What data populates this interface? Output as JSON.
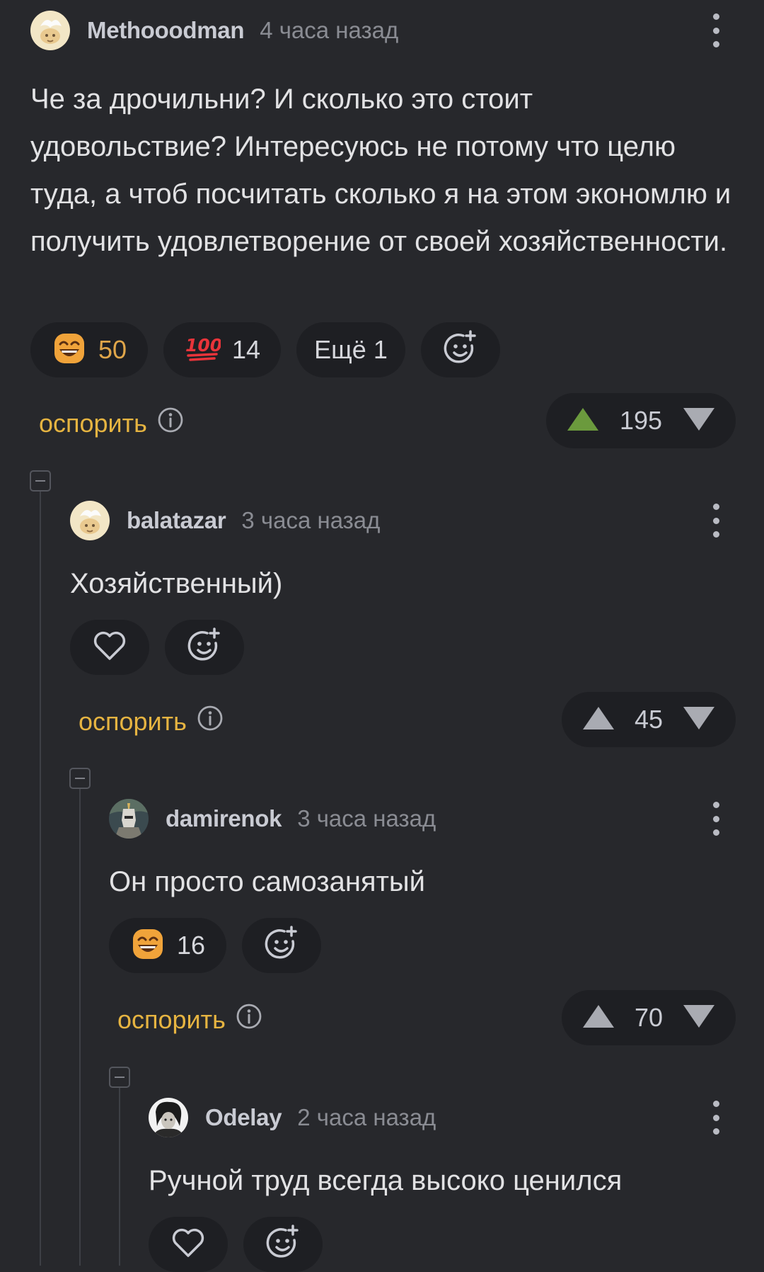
{
  "labels": {
    "dispute": "оспорить",
    "more_reactions_prefix": "Ещё"
  },
  "colors": {
    "background": "#27282c",
    "pill_background": "#1e1f23",
    "dispute_link": "#e6b441",
    "upvote_active": "#6b9a3d",
    "arrow_default": "#a9abb2",
    "active_reaction_count": "#e0a64a"
  },
  "comments": [
    {
      "author": "Methooodman",
      "time": "4 часа назад",
      "avatar_icon": "cat-avatar-icon",
      "text": "Че за дрочильни? И сколько это стоит удовольствие? Интересуюсь не потому что целю туда, а чтоб посчитать сколько я на этом экономлю и получить удовлетворение от своей хозяйственности.",
      "reactions": [
        {
          "icon": "grinning-face-emoji-icon",
          "count": "50",
          "active": true
        },
        {
          "icon": "hundred-points-emoji-icon",
          "count": "14",
          "active": false
        }
      ],
      "more_count": "1",
      "rating": "195",
      "upvoted": true
    },
    {
      "author": "balatazar",
      "time": "3 часа назад",
      "avatar_icon": "cat-avatar-icon",
      "text": "Хозяйственный)",
      "reactions": [],
      "rating": "45",
      "upvoted": false
    },
    {
      "author": "damirenok",
      "time": "3 часа назад",
      "avatar_icon": "knight-avatar-icon",
      "text": "Он просто самозанятый",
      "reactions": [
        {
          "icon": "grinning-face-emoji-icon",
          "count": "16",
          "active": false
        }
      ],
      "rating": "70",
      "upvoted": false
    },
    {
      "author": "Odelay",
      "time": "2 часа назад",
      "avatar_icon": "portrait-avatar-icon",
      "text": "Ручной труд всегда высоко ценился",
      "reactions": []
    }
  ]
}
